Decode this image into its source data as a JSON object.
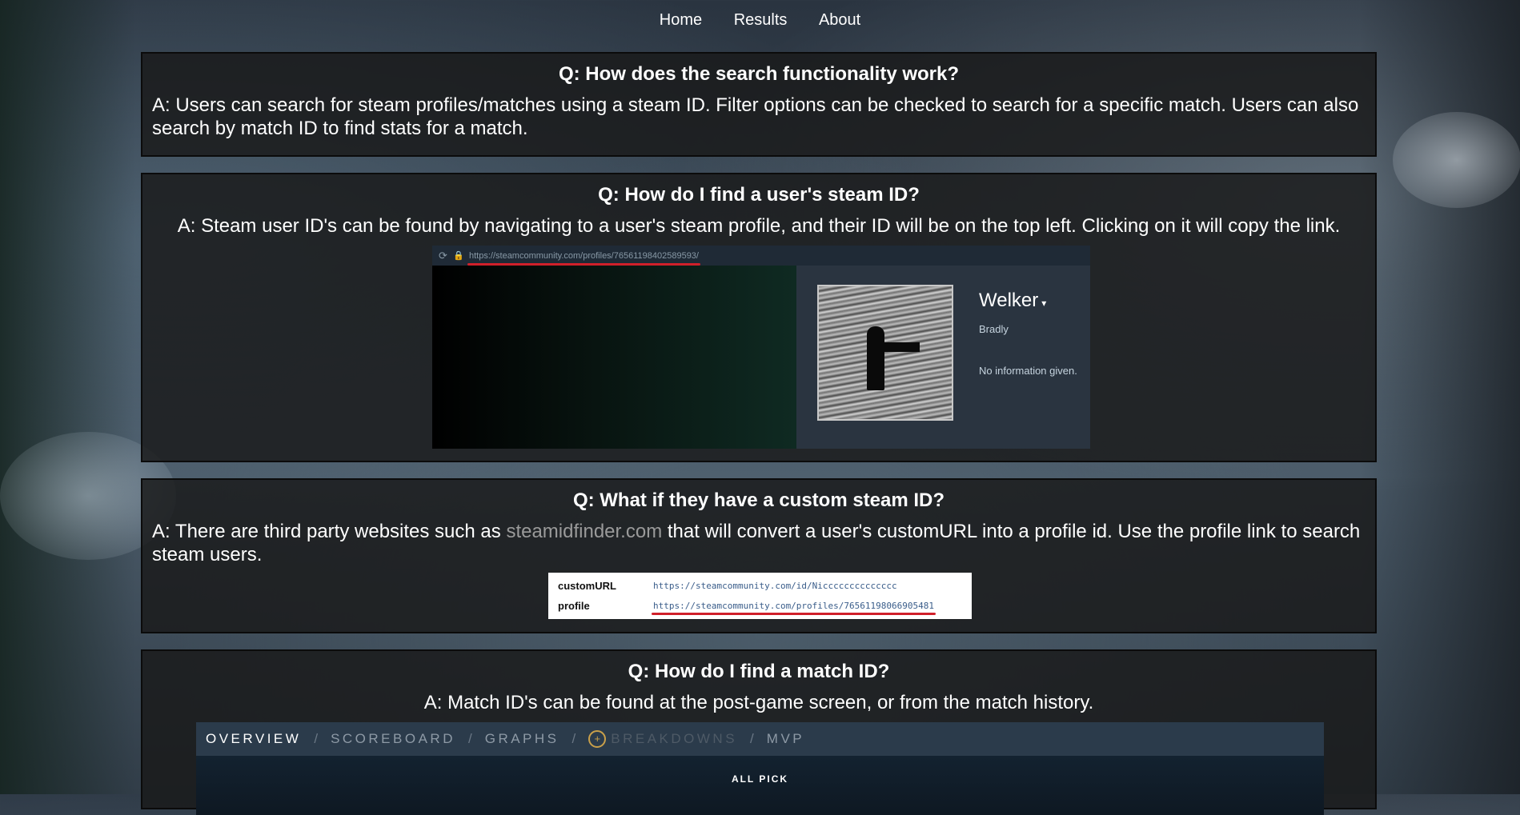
{
  "nav": {
    "home": "Home",
    "results": "Results",
    "about": "About"
  },
  "faq": [
    {
      "question": "Q: How does the search functionality work?",
      "answer": "A: Users can search for steam profiles/matches using a steam ID. Filter options can be checked to search for a specific match. Users can also search by match ID to find stats for a match."
    },
    {
      "question": "Q: How do I find a user's steam ID?",
      "answer": "A: Steam user ID's can be found by navigating to a user's steam profile, and their ID will be on the top left. Clicking on it will copy the link.",
      "screenshot": {
        "url": "https://steamcommunity.com/profiles/76561198402589593/",
        "profile_name": "Welker",
        "real_name": "Bradly",
        "info": "No information given."
      }
    },
    {
      "question": "Q: What if they have a custom steam ID?",
      "answer_pre": "A: There are third party websites such as ",
      "answer_link": "steamidfinder.com",
      "answer_post": " that will convert a user's customURL into a profile id. Use the profile link to search steam users.",
      "table": {
        "rows": [
          {
            "label": "customURL",
            "value": "https://steamcommunity.com/id/Nicccccccccccccc"
          },
          {
            "label": "profile",
            "value": "https://steamcommunity.com/profiles/76561198066905481"
          }
        ]
      }
    },
    {
      "question": "Q: How do I find a match ID?",
      "answer": "A: Match ID's can be found at the post-game screen, or from the match history.",
      "screenshot": {
        "tabs": [
          "OVERVIEW",
          "SCOREBOARD",
          "GRAPHS",
          "BREAKDOWNS",
          "MVP"
        ],
        "separator": "/",
        "mode": "ALL PICK"
      }
    }
  ]
}
